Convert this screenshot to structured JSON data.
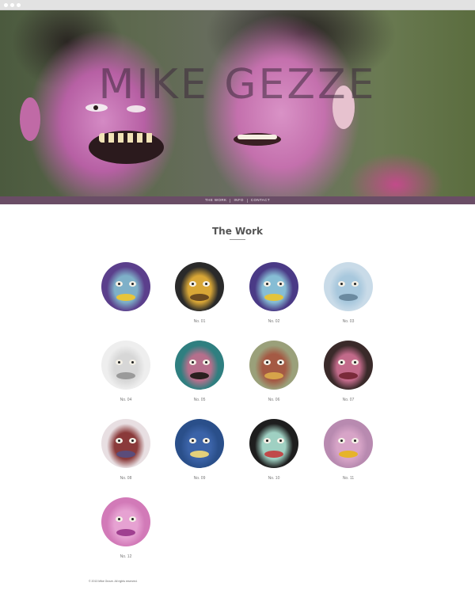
{
  "site": {
    "title": "MIKE GEZZE"
  },
  "nav": {
    "items": [
      "THE WORK",
      "INFO",
      "CONTACT"
    ]
  },
  "section": {
    "title": "The Work"
  },
  "works": [
    {
      "label": "",
      "bg": "#5b3f8c",
      "face": "#7eb0c8",
      "accent": "#e7c53a"
    },
    {
      "label": "No. 01",
      "bg": "#2a2a2a",
      "face": "#d8a636",
      "accent": "#6b4a20"
    },
    {
      "label": "No. 02",
      "bg": "#4a3a86",
      "face": "#86bdd4",
      "accent": "#e3c43c"
    },
    {
      "label": "No. 03",
      "bg": "#c9dbe8",
      "face": "#a8c8dd",
      "accent": "#6b8aa0"
    },
    {
      "label": "No. 04",
      "bg": "#eeeeee",
      "face": "#d7d7d7",
      "accent": "#9a9a9a"
    },
    {
      "label": "No. 05",
      "bg": "#2f7f80",
      "face": "#b66f8c",
      "accent": "#2a1f1f"
    },
    {
      "label": "No. 06",
      "bg": "#9aa07a",
      "face": "#a45a44",
      "accent": "#d6a44a"
    },
    {
      "label": "No. 07",
      "bg": "#3a2a2a",
      "face": "#c26a8a",
      "accent": "#7a2a3a"
    },
    {
      "label": "No. 08",
      "bg": "#e8dfe2",
      "face": "#8a3a3a",
      "accent": "#5b4c7a"
    },
    {
      "label": "No. 09",
      "bg": "#2a4f8a",
      "face": "#3b63a8",
      "accent": "#e3d07a"
    },
    {
      "label": "No. 10",
      "bg": "#1e1e1e",
      "face": "#9fd0c2",
      "accent": "#c04a4a"
    },
    {
      "label": "No. 11",
      "bg": "#b88ab0",
      "face": "#d7a4c7",
      "accent": "#e6b42a"
    },
    {
      "label": "No. 12",
      "bg": "#d27ab8",
      "face": "#e6a2d2",
      "accent": "#a04090"
    }
  ],
  "footer": {
    "text": "© 2013 Mike Gezze. All rights reserved."
  }
}
